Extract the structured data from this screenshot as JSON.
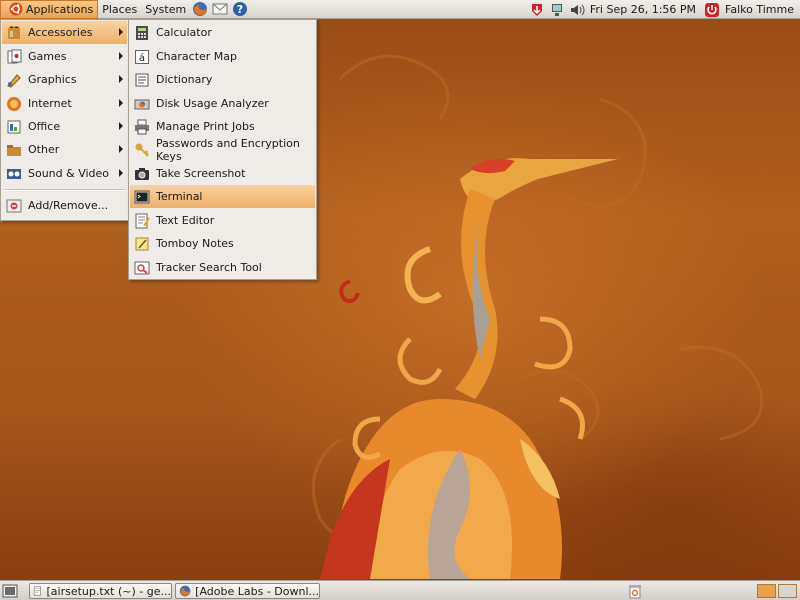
{
  "top_panel": {
    "menus": {
      "applications": "Applications",
      "places": "Places",
      "system": "System"
    },
    "launchers": [
      "firefox-icon",
      "mail-icon",
      "help-icon"
    ],
    "clock": "Fri Sep 26,  1:56 PM",
    "user": "Falko Timme"
  },
  "applications_menu": {
    "items": [
      {
        "label": "Accessories",
        "icon": "accessories-icon",
        "submenu": true,
        "highlighted": true
      },
      {
        "label": "Games",
        "icon": "games-icon",
        "submenu": true
      },
      {
        "label": "Graphics",
        "icon": "graphics-icon",
        "submenu": true
      },
      {
        "label": "Internet",
        "icon": "internet-icon",
        "submenu": true
      },
      {
        "label": "Office",
        "icon": "office-icon",
        "submenu": true
      },
      {
        "label": "Other",
        "icon": "other-icon",
        "submenu": true
      },
      {
        "label": "Sound & Video",
        "icon": "sound-video-icon",
        "submenu": true
      },
      {
        "label": "Add/Remove...",
        "icon": "add-remove-icon",
        "submenu": false
      }
    ]
  },
  "accessories_menu": {
    "items": [
      {
        "label": "Calculator",
        "icon": "calculator-icon"
      },
      {
        "label": "Character Map",
        "icon": "character-map-icon"
      },
      {
        "label": "Dictionary",
        "icon": "dictionary-icon"
      },
      {
        "label": "Disk Usage Analyzer",
        "icon": "disk-usage-icon"
      },
      {
        "label": "Manage Print Jobs",
        "icon": "printer-icon"
      },
      {
        "label": "Passwords and Encryption Keys",
        "icon": "keys-icon"
      },
      {
        "label": "Take Screenshot",
        "icon": "camera-icon"
      },
      {
        "label": "Terminal",
        "icon": "terminal-icon",
        "highlighted": true
      },
      {
        "label": "Text Editor",
        "icon": "text-editor-icon"
      },
      {
        "label": "Tomboy Notes",
        "icon": "tomboy-icon"
      },
      {
        "label": "Tracker Search Tool",
        "icon": "tracker-search-icon"
      }
    ]
  },
  "bottom_panel": {
    "tasks": [
      {
        "label": "[airsetup.txt (~) - ge...",
        "icon": "text-editor-icon"
      },
      {
        "label": "[Adobe Labs - Downl...",
        "icon": "firefox-icon"
      }
    ],
    "workspaces": 2,
    "active_workspace": 1
  },
  "colors": {
    "panel": "#dedad3",
    "menu_bg": "#efebe7",
    "highlight": "#f0b067",
    "desktop": "#a9591c"
  }
}
